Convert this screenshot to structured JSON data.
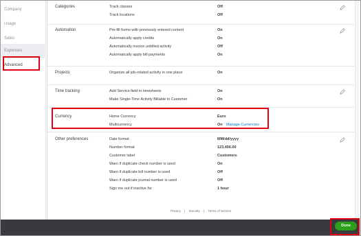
{
  "sidebar": {
    "items": [
      {
        "label": "Company"
      },
      {
        "label": "Usage"
      },
      {
        "label": "Sales"
      },
      {
        "label": "Expenses"
      },
      {
        "label": "Advanced"
      }
    ]
  },
  "sections": {
    "categories": {
      "label": "Categories",
      "rows": [
        {
          "label": "Track classes",
          "value": "Off"
        },
        {
          "label": "Track locations",
          "value": "Off"
        }
      ]
    },
    "automation": {
      "label": "Automation",
      "rows": [
        {
          "label": "Pre-fill forms with previously entered content",
          "value": "On"
        },
        {
          "label": "Automatically apply credits",
          "value": "On"
        },
        {
          "label": "Automatically invoice unbilled activity",
          "value": "Off"
        },
        {
          "label": "Automatically apply bill payments",
          "value": "On"
        }
      ]
    },
    "projects": {
      "label": "Projects",
      "rows": [
        {
          "label": "Organize all job-related activity in one place",
          "value": "On"
        }
      ]
    },
    "time_tracking": {
      "label": "Time tracking",
      "rows": [
        {
          "label": "Add Service field to timesheets",
          "value": "On"
        },
        {
          "label": "Make Single-Time Activity Billable to Customer",
          "value": "On"
        }
      ]
    },
    "currency": {
      "label": "Currency",
      "rows": [
        {
          "label": "Home Currency",
          "value": "Euro"
        },
        {
          "label": "Multicurrency",
          "value": "On",
          "link": "Manage Currencies"
        }
      ]
    },
    "other": {
      "label": "Other preferences",
      "rows": [
        {
          "label": "Date format",
          "value": "MM/dd/yyyy"
        },
        {
          "label": "Number format",
          "value": "123,456.00"
        },
        {
          "label": "Customer label",
          "value": "Customers"
        },
        {
          "label": "Warn if duplicate check number is used",
          "value": "On"
        },
        {
          "label": "Warn if duplicate bill number is used",
          "value": "Off"
        },
        {
          "label": "Warn if duplicate journal number is used",
          "value": "Off"
        },
        {
          "label": "Sign me out if inactive for",
          "value": "1 hour"
        }
      ]
    }
  },
  "footer": {
    "privacy": "Privacy",
    "sep1": "|",
    "security": "Security",
    "sep2": "|",
    "terms": "Terms of Service"
  },
  "bottom_bar": {
    "done_label": "Done"
  },
  "colors": {
    "accent_green": "#2ca01c",
    "link_blue": "#0077c5",
    "highlight_red": "#e0000f",
    "bottom_bar": "#393a3d"
  }
}
